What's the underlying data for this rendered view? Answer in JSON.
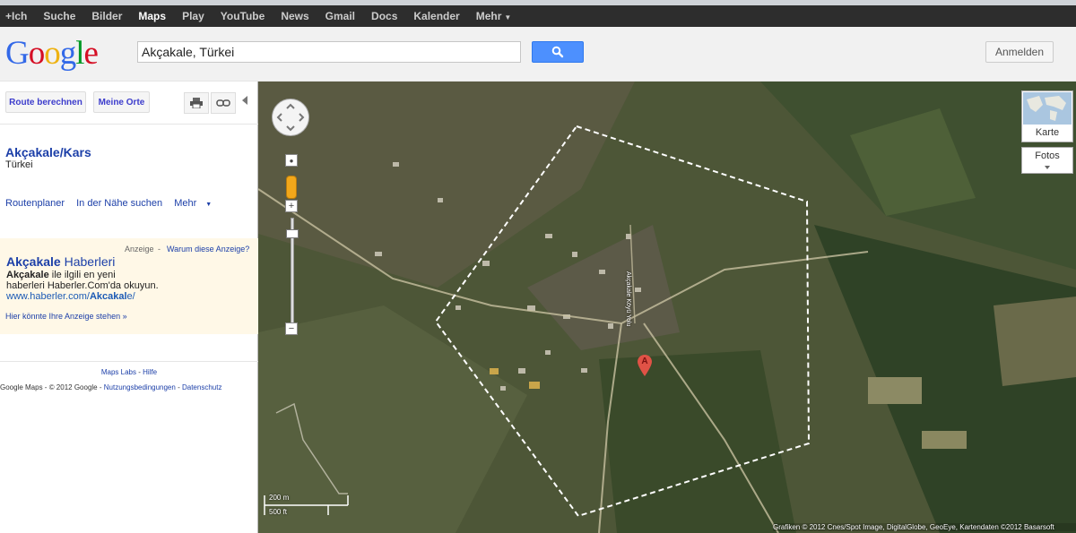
{
  "topbar": {
    "items": [
      "+Ich",
      "Suche",
      "Bilder",
      "Maps",
      "Play",
      "YouTube",
      "News",
      "Gmail",
      "Docs",
      "Kalender",
      "Mehr"
    ],
    "active": "Maps"
  },
  "header": {
    "logo": "Google",
    "search_value": "Akçakale, Türkei",
    "signin_label": "Anmelden"
  },
  "sidebar": {
    "route_button": "Route berechnen",
    "places_button": "Meine Orte",
    "place": {
      "title": "Akçakale/Kars",
      "subtitle": "Türkei"
    },
    "links": {
      "route_planner": "Routenplaner",
      "nearby": "In der Nähe suchen",
      "more": "Mehr"
    },
    "ad": {
      "label": "Anzeige",
      "why": "Warum diese Anzeige?",
      "title_bold": "Akçakale",
      "title_rest": " Haberleri",
      "text_bold": "Akçakale",
      "text_rest": " ile ilgili en yeni",
      "text2": "haberleri Haberler.Com'da okuyun.",
      "url_pre": "www.haberler.com/",
      "url_bold": "Akcakal",
      "url_post": "e/",
      "more": "Hier könnte Ihre Anzeige stehen »"
    },
    "footer": {
      "labs": "Maps Labs",
      "help": "Hilfe",
      "copyright": "Google Maps - © 2012 Google",
      "terms": "Nutzungsbedingungen",
      "privacy": "Datenschutz"
    }
  },
  "map": {
    "map_type": "Karte",
    "photos": "Fotos",
    "road_label": "Akçakale Köyü Yolu",
    "marker_letter": "A",
    "scale_m": "200 m",
    "scale_ft": "500 ft",
    "copyright": "Grafiken © 2012 Cnes/Spot Image, DigitalGlobe, GeoEye, Kartendaten ©2012 Basarsoft"
  }
}
